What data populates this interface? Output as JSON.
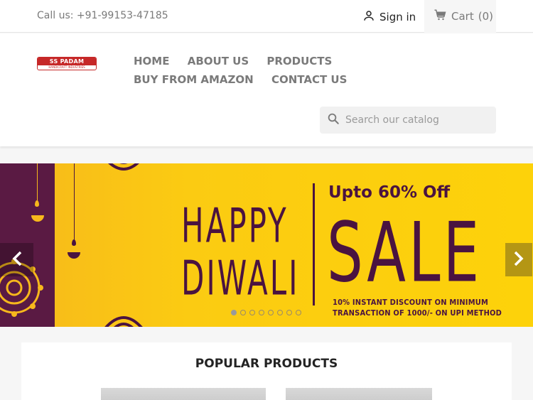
{
  "topbar": {
    "call_text": "Call us: +91-99153-47185",
    "signin_label": "Sign in",
    "cart_label": "Cart",
    "cart_count": "(0)"
  },
  "header": {
    "logo_text": "SS PADAM",
    "logo_subtext": "HANDICRAFT INDUSTRIES",
    "nav": [
      "HOME",
      "ABOUT US",
      "PRODUCTS",
      "BUY FROM AMAZON",
      "CONTACT US"
    ],
    "search_placeholder": "Search our catalog"
  },
  "banner": {
    "line1": "HAPPY",
    "line2": "DIWALI",
    "offer": "Upto 60% Off",
    "sale": "SALE",
    "fine_print_1": "10% INSTANT DISCOUNT ON MINIMUM",
    "fine_print_2": "TRANSACTION OF 1000/- ON UPI METHOD",
    "slides_count": 8,
    "active_slide": 1,
    "colors": {
      "purple": "#4a1340",
      "yellow": "#fdd20a"
    }
  },
  "popular": {
    "title": "POPULAR PRODUCTS"
  },
  "icons": {
    "user": "user-icon",
    "cart": "cart-icon",
    "search": "search-icon",
    "prev": "chevron-left-icon",
    "next": "chevron-right-icon"
  }
}
